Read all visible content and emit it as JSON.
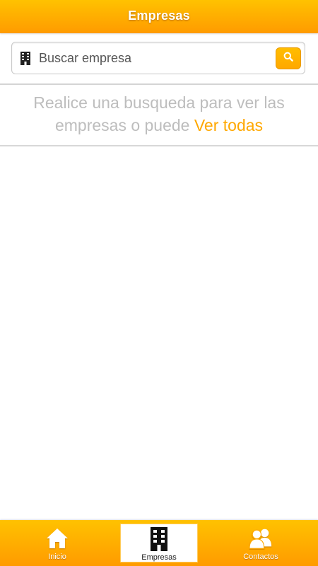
{
  "header": {
    "title": "Empresas"
  },
  "search": {
    "placeholder": "Buscar empresa",
    "value": "",
    "prefix_icon": "building-icon",
    "button_icon": "search-icon"
  },
  "message": {
    "text": "Realice una busqueda para ver las empresas o puede ",
    "link_text": "Ver todas"
  },
  "bottom_nav": {
    "items": [
      {
        "label": "Inicio",
        "icon": "home-icon",
        "active": false
      },
      {
        "label": "Empresas",
        "icon": "building-icon",
        "active": true
      },
      {
        "label": "Contactos",
        "icon": "contacts-icon",
        "active": false
      }
    ]
  },
  "colors": {
    "accent": "#ffa800",
    "header_top": "#ffc200",
    "header_bottom": "#ff9b00",
    "message_text": "#bdbdbd"
  }
}
